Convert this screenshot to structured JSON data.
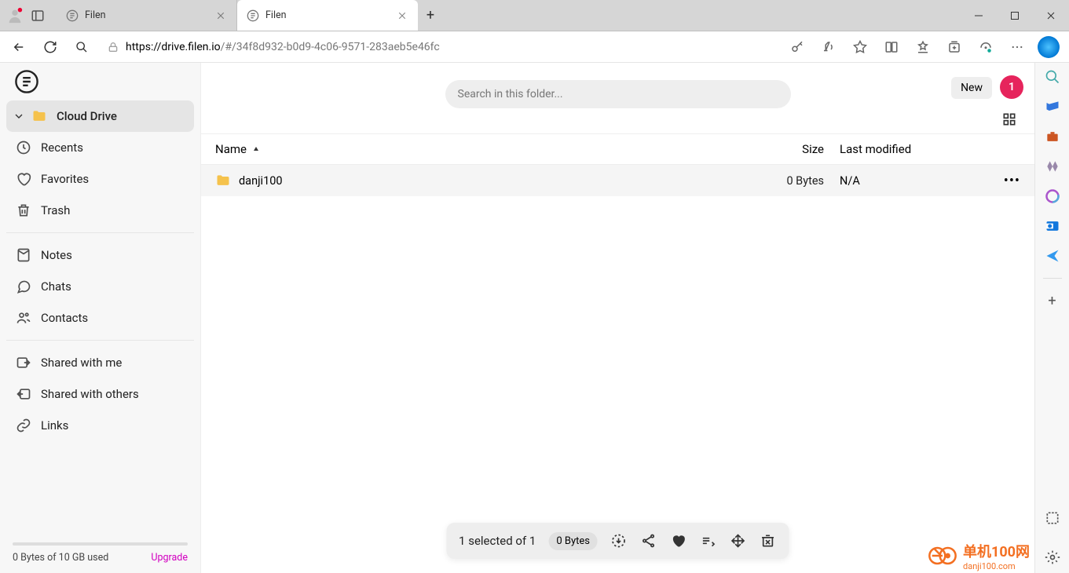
{
  "browser": {
    "tabs": [
      {
        "title": "Filen",
        "active": false
      },
      {
        "title": "Filen",
        "active": true
      }
    ],
    "url_host": "https://drive.filen.io",
    "url_path": "/#/34f8d932-b0d9-4c06-9571-283aeb5e46fc"
  },
  "sidebar": {
    "cloud_drive": "Cloud Drive",
    "recents": "Recents",
    "favorites": "Favorites",
    "trash": "Trash",
    "notes": "Notes",
    "chats": "Chats",
    "contacts": "Contacts",
    "shared_with_me": "Shared with me",
    "shared_with_others": "Shared with others",
    "links": "Links",
    "quota": "0 Bytes of 10 GB used",
    "upgrade": "Upgrade"
  },
  "header": {
    "search_placeholder": "Search in this folder...",
    "new_label": "New",
    "avatar_initial": "1"
  },
  "columns": {
    "name": "Name",
    "size": "Size",
    "modified": "Last modified"
  },
  "rows": [
    {
      "name": "danji100",
      "size": "0 Bytes",
      "modified": "N/A"
    }
  ],
  "actionbar": {
    "selection": "1 selected of 1",
    "size_badge": "0 Bytes"
  },
  "watermark": {
    "line1": "单机100网",
    "line2": "danji100.com"
  }
}
